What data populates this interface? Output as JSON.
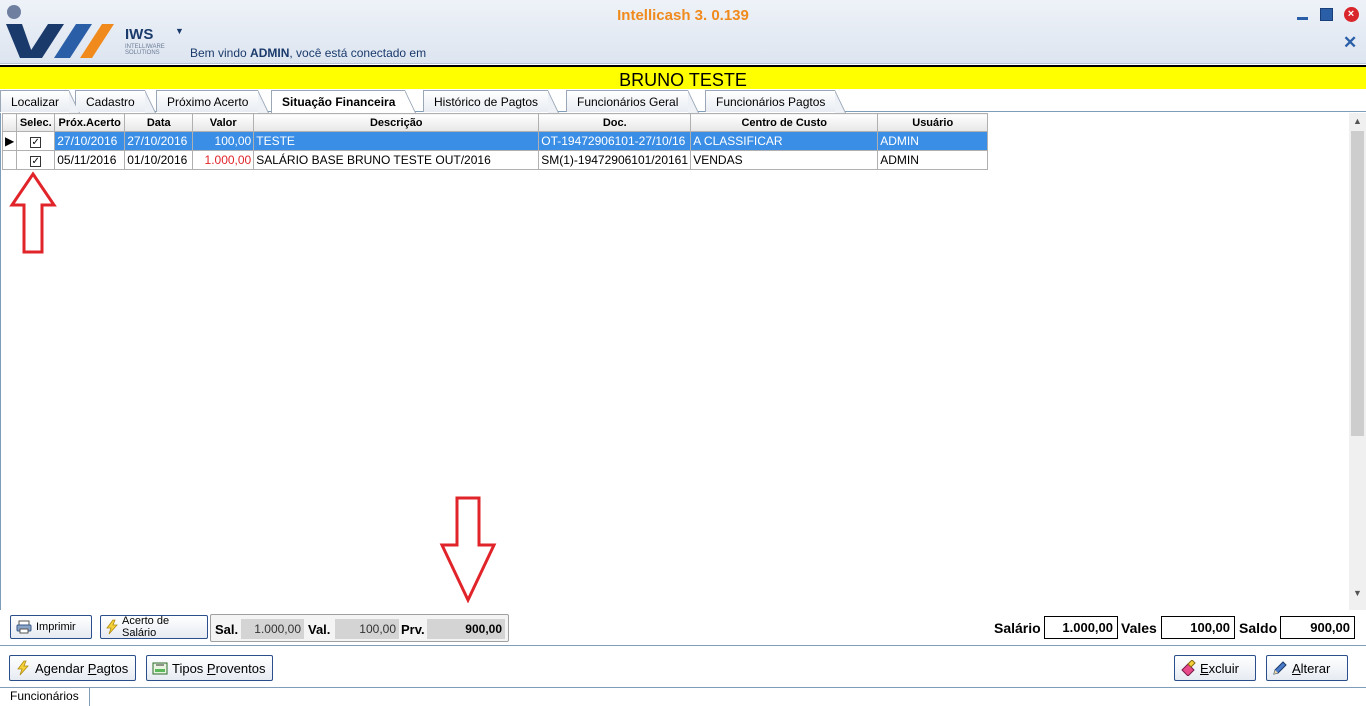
{
  "app": {
    "title": "Intellicash 3. 0.139",
    "logo_text": "IWS",
    "logo_sub": "INTELLIWARE SOLUTIONS",
    "welcome_prefix": "Bem vindo ",
    "welcome_user": "ADMIN",
    "welcome_suffix": ", você está conectado em"
  },
  "employee_name": "BRUNO TESTE",
  "tabs": [
    {
      "label": "Localizar",
      "active": false
    },
    {
      "label": "Cadastro",
      "active": false
    },
    {
      "label": "Próximo Acerto",
      "active": false
    },
    {
      "label": "Situação Financeira",
      "active": true
    },
    {
      "label": "Histórico de Pagtos",
      "active": false
    },
    {
      "label": "Funcionários Geral",
      "active": false
    },
    {
      "label": "Funcionários Pagtos",
      "active": false
    }
  ],
  "grid": {
    "columns": [
      "Selec.",
      "Próx.Acerto",
      "Data",
      "Valor",
      "Descrição",
      "Doc.",
      "Centro de Custo",
      "Usuário"
    ],
    "rows": [
      {
        "checked": true,
        "prox": "27/10/2016",
        "data": "27/10/2016",
        "valor": "100,00",
        "desc": "TESTE",
        "doc": "OT-19472906101-27/10/16",
        "centro": "A CLASSIFICAR",
        "usuario": "ADMIN",
        "selected": true,
        "valor_color": "#ffffff"
      },
      {
        "checked": true,
        "prox": "05/11/2016",
        "data": "01/10/2016",
        "valor": "1.000,00",
        "desc": "SALÁRIO BASE BRUNO TESTE OUT/2016",
        "doc": "SM(1)-19472906101/20161",
        "centro": "VENDAS",
        "usuario": "ADMIN",
        "selected": false,
        "valor_color": "#e0242a"
      }
    ]
  },
  "footer1": {
    "imprimir": "Imprimir",
    "acerto": "Acerto de Salário",
    "sal_label": "Sal.",
    "sal_value": "1.000,00",
    "val_label": "Val.",
    "val_value": "100,00",
    "prv_label": "Prv.",
    "prv_value": "900,00",
    "salario_label": "Salário",
    "salario_value": "1.000,00",
    "vales_label": "Vales",
    "vales_value": "100,00",
    "saldo_label": "Saldo",
    "saldo_value": "900,00"
  },
  "footer2": {
    "agendar_prefix": "Agendar ",
    "agendar_underlined": "P",
    "agendar_suffix": "agtos",
    "tipos_prefix": "Tipos ",
    "tipos_underlined": "P",
    "tipos_suffix": "roventos",
    "excluir_underlined": "E",
    "excluir_suffix": "xcluir",
    "alterar_underlined": "A",
    "alterar_suffix": "lterar"
  },
  "status": {
    "tab_label": "Funcionários"
  },
  "colors": {
    "accent_orange": "#f08a1c",
    "name_bar": "#ffff00",
    "selection_blue": "#3a8ee6",
    "annotation_red": "#e0242a"
  }
}
